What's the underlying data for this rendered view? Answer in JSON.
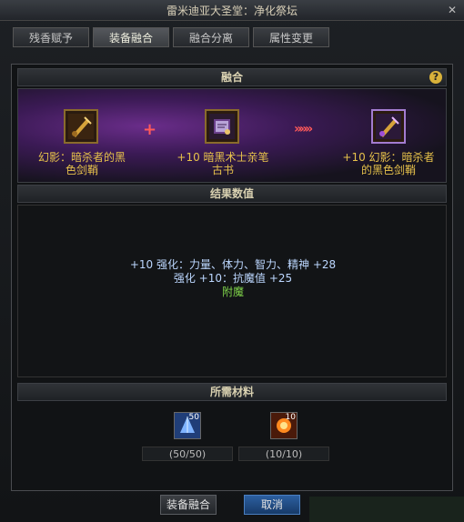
{
  "window": {
    "title": "雷米迪亚大圣堂：净化祭坛"
  },
  "tabs": [
    {
      "label": "残香赋予"
    },
    {
      "label": "装备融合"
    },
    {
      "label": "融合分离"
    },
    {
      "label": "属性变更"
    }
  ],
  "active_tab": 1,
  "fusion": {
    "header": "融合",
    "items": [
      {
        "label_line1": "幻影：暗杀者的黑",
        "label_line2": "色剑鞘",
        "icon": "sword-sheath-icon"
      },
      {
        "label_line1": "+10 暗黑术士亲笔",
        "label_line2": "古书",
        "icon": "tome-icon"
      },
      {
        "label_line1": "+10 幻影：暗杀者",
        "label_line2": "的黑色剑鞘",
        "icon": "sword-sheath-purple-icon"
      }
    ],
    "plus_symbol": "+",
    "arrow_symbol": "»»»"
  },
  "result": {
    "header": "结果数值",
    "line1": "+10 强化：力量、体力、智力、精神 +28",
    "line2": "强化 +10：抗魔值 +25",
    "line3": "附魔",
    "colors": {
      "stat": "#bcd7ff",
      "enchant": "#7fd34a"
    }
  },
  "materials": {
    "header": "所需材料",
    "items": [
      {
        "icon": "blue-crystal-icon",
        "badge": "50",
        "count_text": "(50/50)"
      },
      {
        "icon": "fire-orb-icon",
        "badge": "10",
        "count_text": "(10/10)"
      }
    ]
  },
  "buttons": {
    "confirm": "装备融合",
    "cancel": "取消"
  },
  "colors": {
    "item_label": "#e6c14b",
    "plus": "#ff5a5a",
    "cancel_btn": "#1f4f8a"
  }
}
